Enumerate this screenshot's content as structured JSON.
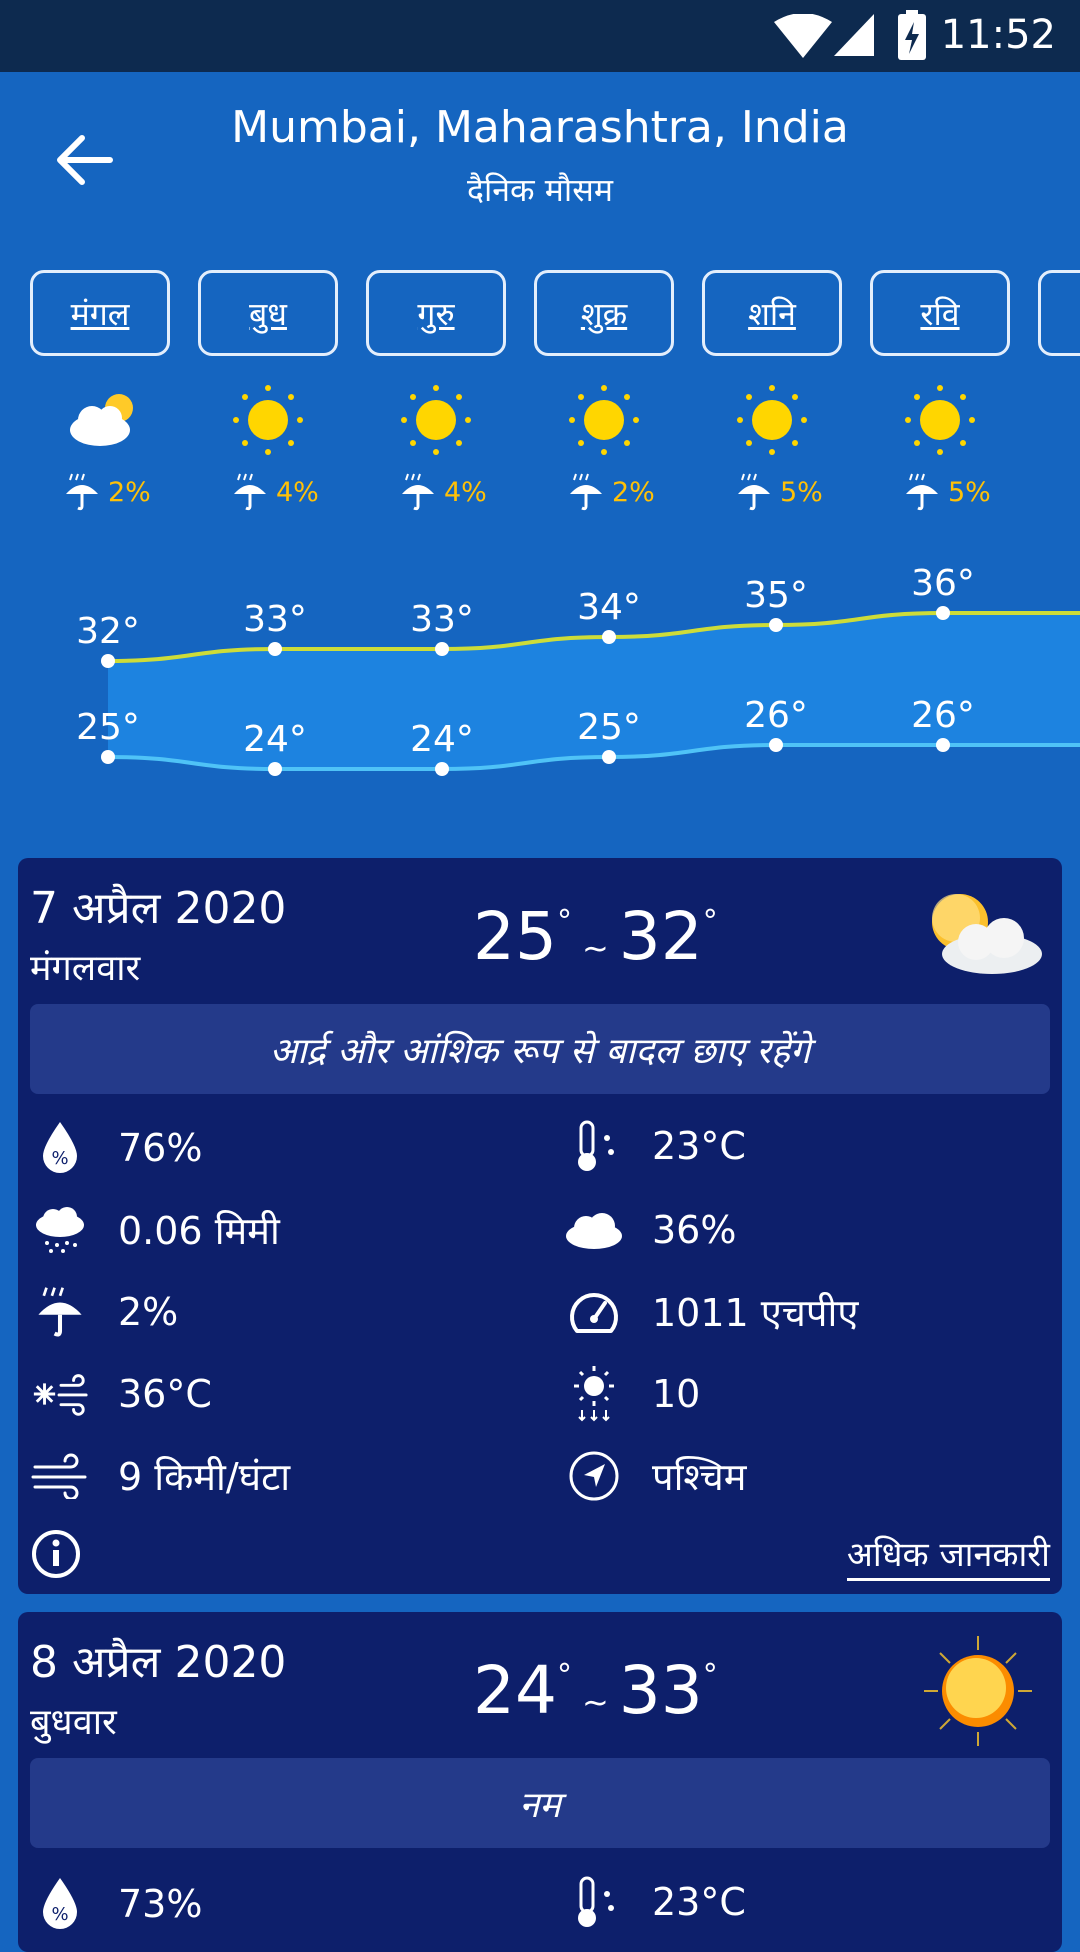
{
  "status_bar": {
    "time": "11:52"
  },
  "header": {
    "title": "Mumbai, Maharashtra, India",
    "subtitle": "दैनिक मौसम"
  },
  "days": [
    {
      "label": "मंगल",
      "icon": "partly-cloudy-icon",
      "precip": "2%"
    },
    {
      "label": "बुध",
      "icon": "sun-icon",
      "precip": "4%"
    },
    {
      "label": "गुरु",
      "icon": "sun-icon",
      "precip": "4%"
    },
    {
      "label": "शुक्र",
      "icon": "sun-icon",
      "precip": "2%"
    },
    {
      "label": "शनि",
      "icon": "sun-icon",
      "precip": "5%"
    },
    {
      "label": "रवि",
      "icon": "sun-icon",
      "precip": "5%"
    }
  ],
  "chart_data": {
    "type": "line",
    "categories": [
      "मंगल",
      "बुध",
      "गुरु",
      "शुक्र",
      "शनि",
      "रवि"
    ],
    "series": [
      {
        "values": [
          32,
          33,
          33,
          34,
          35,
          36
        ],
        "labels": [
          "32°",
          "33°",
          "33°",
          "34°",
          "35°",
          "36°"
        ],
        "color": "#cddc39"
      },
      {
        "values": [
          25,
          24,
          24,
          25,
          26,
          26
        ],
        "labels": [
          "25°",
          "24°",
          "24°",
          "25°",
          "26°",
          "26°"
        ],
        "color": "#4fc3f7"
      }
    ],
    "fill_color": "#1e88e5"
  },
  "cards": [
    {
      "date": "7 अप्रैल 2020",
      "weekday": "मंगलवार",
      "temp_min": "25",
      "temp_max": "32",
      "deg": "°",
      "tilde": "~",
      "icon": "partly-cloudy-icon",
      "description": "आर्द्र और आंशिक रूप से बादल छाए रहेंगे",
      "humidity": "76%",
      "dew_point": "23°C",
      "rain": "0.06 मिमी",
      "cloud_cover": "36%",
      "precip_chance": "2%",
      "pressure": "1011 एचपीए",
      "feels_like": "36°C",
      "uv_index": "10",
      "wind_speed": "9 किमी/घंटा",
      "wind_direction": "पश्चिम",
      "more_info": "अधिक जानकारी"
    },
    {
      "date": "8 अप्रैल 2020",
      "weekday": "बुधवार",
      "temp_min": "24",
      "temp_max": "33",
      "deg": "°",
      "tilde": "~",
      "icon": "sun-icon",
      "description": "नम",
      "humidity": "73%",
      "dew_point": "23°C"
    }
  ]
}
